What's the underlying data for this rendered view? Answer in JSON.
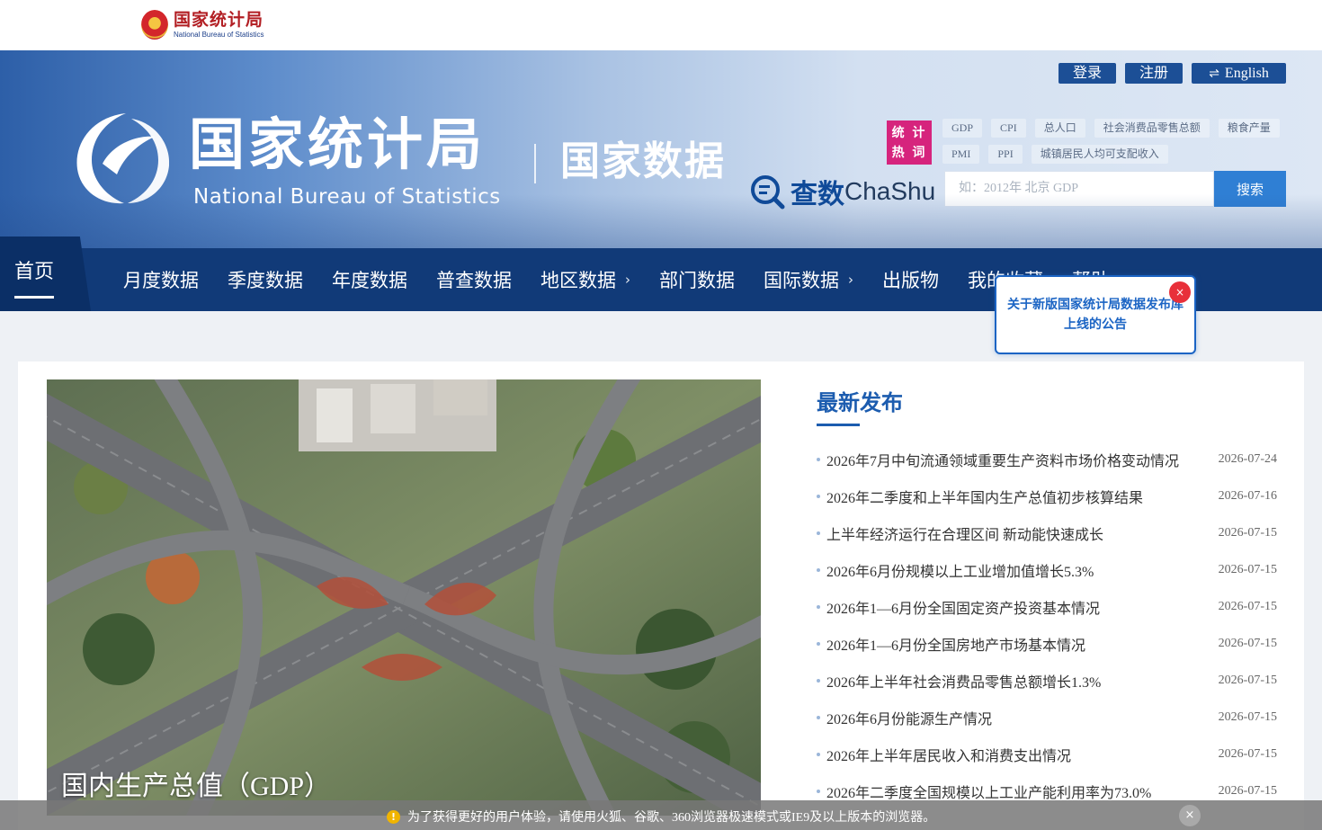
{
  "top_logo": {
    "cn": "国家统计局",
    "en": "National Bureau of Statistics"
  },
  "banner": {
    "title_cn": "国家统计局",
    "title_en": "National Bureau of Statistics",
    "subtitle": "国家数据",
    "login": "登录",
    "register": "注册",
    "english": "English",
    "hot_label_line1": "统 计",
    "hot_label_line2": "热 词",
    "hot_row1": [
      "GDP",
      "CPI",
      "总人口",
      "社会消费品零售总额",
      "粮食产量"
    ],
    "hot_row2": [
      "PMI",
      "PPI",
      "城镇居民人均可支配收入"
    ],
    "chashu_cn": "查数",
    "chashu_en": "ChaShu",
    "search_placeholder": "如：2012年 北京 GDP",
    "search_button": "搜索"
  },
  "nav": {
    "home": "首页",
    "items": [
      "月度数据",
      "季度数据",
      "年度数据",
      "普查数据",
      "地区数据",
      "部门数据",
      "国际数据",
      "出版物",
      "我的收藏",
      "帮助"
    ]
  },
  "popup": {
    "text": "关于新版国家统计局数据发布库上线的公告",
    "close": "×"
  },
  "hero": {
    "caption": "国内生产总值（GDP）"
  },
  "news": {
    "title": "最新发布",
    "items": [
      {
        "text": "2026年7月中旬流通领域重要生产资料市场价格变动情况",
        "date": "2026-07-24"
      },
      {
        "text": "2026年二季度和上半年国内生产总值初步核算结果",
        "date": "2026-07-16"
      },
      {
        "text": "上半年经济运行在合理区间 新动能快速成长",
        "date": "2026-07-15"
      },
      {
        "text": "2026年6月份规模以上工业增加值增长5.3%",
        "date": "2026-07-15"
      },
      {
        "text": "2026年1—6月份全国固定资产投资基本情况",
        "date": "2026-07-15"
      },
      {
        "text": "2026年1—6月份全国房地产市场基本情况",
        "date": "2026-07-15"
      },
      {
        "text": "2026年上半年社会消费品零售总额增长1.3%",
        "date": "2026-07-15"
      },
      {
        "text": "2026年6月份能源生产情况",
        "date": "2026-07-15"
      },
      {
        "text": "2026年上半年居民收入和消费支出情况",
        "date": "2026-07-15"
      },
      {
        "text": "2026年二季度全国规模以上工业产能利用率为73.0%",
        "date": "2026-07-15"
      }
    ]
  },
  "notice": {
    "text": "为了获得更好的用户体验，请使用火狐、谷歌、360浏览器极速模式或IE9及以上版本的浏览器。",
    "icon": "!",
    "close": "×"
  },
  "colors": {
    "nav": "#113a78",
    "accent": "#1c5caf",
    "hot": "#d6247d",
    "search": "#2f7fd4",
    "alert": "#e8303a"
  }
}
